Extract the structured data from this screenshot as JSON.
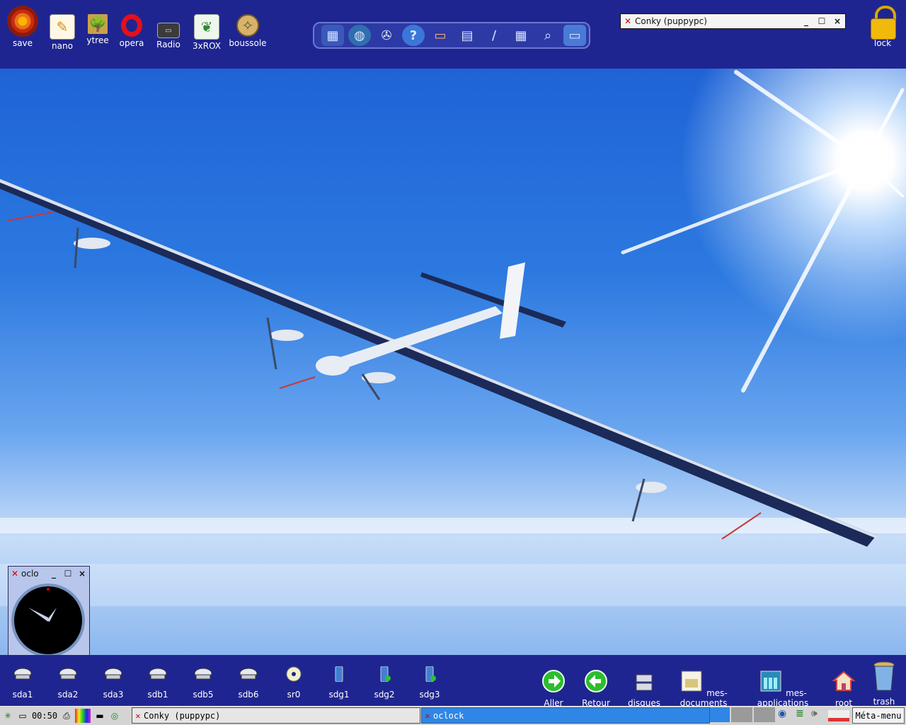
{
  "desktop_top_icons": [
    {
      "label": "save",
      "icon": "save-target-icon"
    },
    {
      "label": "nano",
      "icon": "notepad-pencil-icon"
    },
    {
      "label": "ytree",
      "icon": "ytree-icon"
    },
    {
      "label": "opera",
      "icon": "opera-o-icon"
    },
    {
      "label": "Radio",
      "icon": "radio-receiver-icon"
    },
    {
      "label": "3xROX",
      "icon": "rox-tree-icon"
    },
    {
      "label": "boussole",
      "icon": "compass-icon"
    }
  ],
  "launcher_bar": {
    "buttons": [
      "desktop-icon",
      "globe-icon",
      "film-reel-icon",
      "help-icon",
      "briefcase-icon",
      "find-document-icon",
      "draw-icon",
      "calculator-icon",
      "magnifier-icon",
      "monitor-icon"
    ]
  },
  "conky_window": {
    "title": "Conky (puppypc)"
  },
  "lock": {
    "label": "lock"
  },
  "oclock_window": {
    "title": "oclo"
  },
  "drives": [
    "sda1",
    "sda2",
    "sda3",
    "sdb1",
    "sdb5",
    "sdb6",
    "sr0",
    "sdg1",
    "sdg2",
    "sdg3"
  ],
  "bottom_apps": [
    {
      "label": "Aller",
      "icon": "go-forward-icon"
    },
    {
      "label": "Retour",
      "icon": "go-back-icon"
    },
    {
      "label": "disques",
      "icon": "disks-icon"
    },
    {
      "label": "mes-documents",
      "icon": "documents-icon"
    },
    {
      "label": "mes-applications",
      "icon": "applications-icon"
    },
    {
      "label": "root",
      "icon": "home-icon"
    },
    {
      "label": "trash",
      "icon": "trash-icon"
    }
  ],
  "taskbar": {
    "time": "00:50",
    "tasks": [
      {
        "label": "Conky (puppypc)"
      },
      {
        "label": "oclock"
      }
    ],
    "menu_label": "Méta-menu"
  },
  "colors": {
    "panel": "#1f2590",
    "accent_red": "#d10000",
    "sky": "#2c79e0"
  }
}
